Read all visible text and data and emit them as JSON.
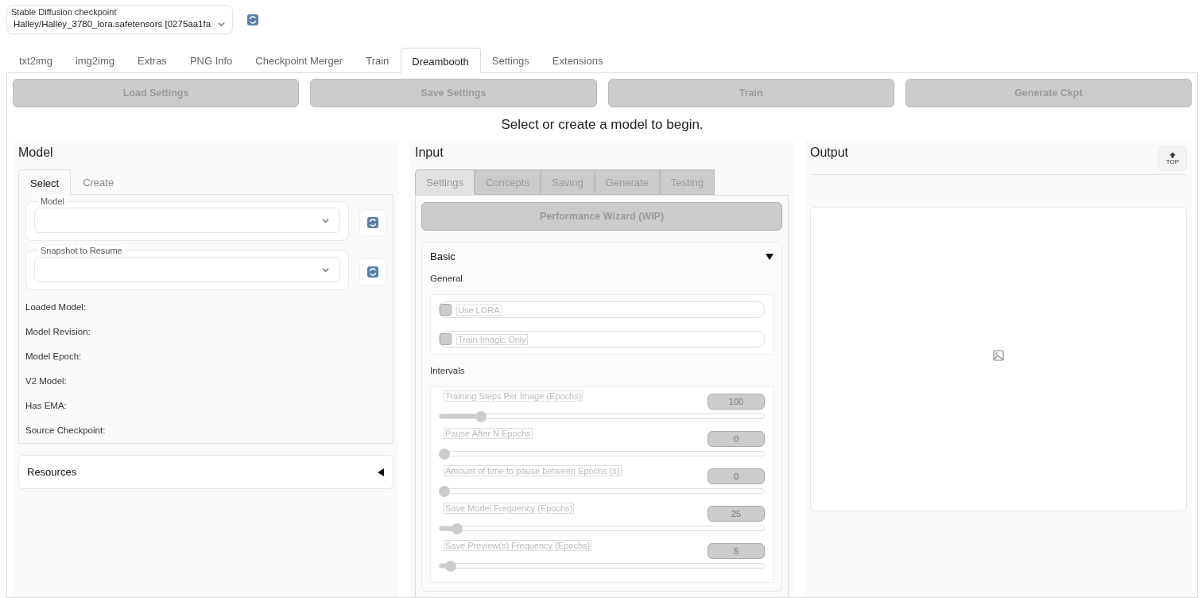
{
  "checkpoint": {
    "label": "Stable Diffusion checkpoint",
    "value": "Halley/Halley_3780_lora.safetensors [0275aa1fa"
  },
  "tabs": [
    {
      "label": "txt2img",
      "selected": false
    },
    {
      "label": "img2img",
      "selected": false
    },
    {
      "label": "Extras",
      "selected": false
    },
    {
      "label": "PNG Info",
      "selected": false
    },
    {
      "label": "Checkpoint Merger",
      "selected": false
    },
    {
      "label": "Train",
      "selected": false
    },
    {
      "label": "Dreambooth",
      "selected": true
    },
    {
      "label": "Settings",
      "selected": false
    },
    {
      "label": "Extensions",
      "selected": false
    }
  ],
  "action_buttons": [
    "Load Settings",
    "Save Settings",
    "Train",
    "Generate Ckpt"
  ],
  "message": "Select or create a model to begin.",
  "model_panel": {
    "title": "Model",
    "tabs": [
      {
        "label": "Select",
        "selected": true
      },
      {
        "label": "Create",
        "selected": false
      }
    ],
    "dropdowns": [
      {
        "label": "Model"
      },
      {
        "label": "Snapshot to Resume"
      }
    ],
    "info": [
      "Loaded Model:",
      "Model Revision:",
      "Model Epoch:",
      "V2 Model:",
      "Has EMA:",
      "Source Checkpoint:"
    ],
    "resources": {
      "label": "Resources",
      "expanded": false
    }
  },
  "input_panel": {
    "title": "Input",
    "tabs": [
      {
        "label": "Settings",
        "selected": true
      },
      {
        "label": "Concepts",
        "selected": false
      },
      {
        "label": "Saving",
        "selected": false
      },
      {
        "label": "Generate",
        "selected": false
      },
      {
        "label": "Testing",
        "selected": false
      }
    ],
    "wizard_button": "Performance Wizard (WIP)",
    "basic": {
      "label": "Basic",
      "expanded": true,
      "general_label": "General",
      "checkboxes": [
        {
          "label": "Use LORA",
          "checked": false
        },
        {
          "label": "Train Imagic Only",
          "checked": false
        }
      ],
      "intervals_label": "Intervals",
      "sliders": [
        {
          "label": "Training Steps Per Image (Epochs)",
          "value": "100",
          "level": 0.115
        },
        {
          "label": "Pause After N Epochs",
          "value": "0",
          "level": 0
        },
        {
          "label": "Amount of time to pause between Epochs (s)",
          "value": "0",
          "level": 0
        },
        {
          "label": "Save Model Frequency (Epochs)",
          "value": "25",
          "level": 0.04
        },
        {
          "label": "Save Preview(s) Frequency (Epochs)",
          "value": "5",
          "level": 0.02
        }
      ]
    }
  },
  "output_panel": {
    "title": "Output",
    "top_button": "TOP"
  }
}
